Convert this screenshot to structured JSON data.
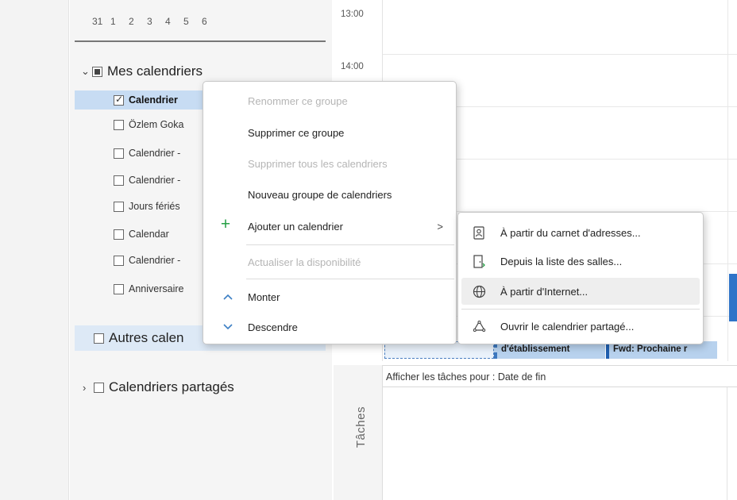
{
  "mini_calendar": {
    "days": [
      "31",
      "1",
      "2",
      "3",
      "4",
      "5",
      "6"
    ]
  },
  "my_calendars": {
    "title": "Mes calendriers",
    "items": [
      {
        "label": "Calendrier",
        "checked": true,
        "selected": true
      },
      {
        "label": "Özlem Goka",
        "checked": false
      },
      {
        "label": "Calendrier -",
        "checked": false
      },
      {
        "label": "Calendrier -",
        "checked": false
      },
      {
        "label": "Jours fériés",
        "checked": false
      },
      {
        "label": "Calendar",
        "checked": false
      },
      {
        "label": "Calendrier -",
        "checked": false
      },
      {
        "label": "Anniversaire",
        "checked": false
      }
    ]
  },
  "other_calendars": {
    "title": "Autres calen"
  },
  "shared_calendars": {
    "title": "Calendriers partagés"
  },
  "time_slots": [
    "13:00",
    "14:00"
  ],
  "events": {
    "event_b": "d'établissement",
    "event_c": "Fwd: Prochaine r"
  },
  "tasks": {
    "header": "Afficher les tâches pour : Date de fin",
    "side_label": "Tâches"
  },
  "context_menu": {
    "items": [
      {
        "label": "Renommer ce groupe",
        "disabled": true,
        "icon": ""
      },
      {
        "label": "Supprimer ce groupe",
        "disabled": false,
        "icon": ""
      },
      {
        "label": "Supprimer tous les calendriers",
        "disabled": true,
        "icon": ""
      },
      {
        "label": "Nouveau groupe de calendriers",
        "disabled": false,
        "icon": ""
      },
      {
        "label": "Ajouter un calendrier",
        "disabled": false,
        "icon": "plus-icon",
        "submenu": true
      },
      {
        "label": "Actualiser la disponibilité",
        "disabled": true,
        "icon": ""
      },
      {
        "label": "Monter",
        "disabled": false,
        "icon": "chevron-up-icon"
      },
      {
        "label": "Descendre",
        "disabled": false,
        "icon": "chevron-down-icon"
      }
    ],
    "submenu_arrow": ">"
  },
  "sub_menu": {
    "items": [
      {
        "label": "À partir du carnet d'adresses...",
        "icon": "address-book-icon"
      },
      {
        "label": "Depuis la liste des salles...",
        "icon": "room-list-icon"
      },
      {
        "label": "À partir d'Internet...",
        "icon": "globe-icon"
      },
      {
        "label": "Ouvrir le calendrier partagé...",
        "icon": "shared-calendar-icon"
      }
    ]
  },
  "colors": {
    "selection": "#c7dcf3",
    "event_blue": "#b8d2ee",
    "accent_blue": "#2f74c8",
    "plus_green": "#27a046"
  }
}
